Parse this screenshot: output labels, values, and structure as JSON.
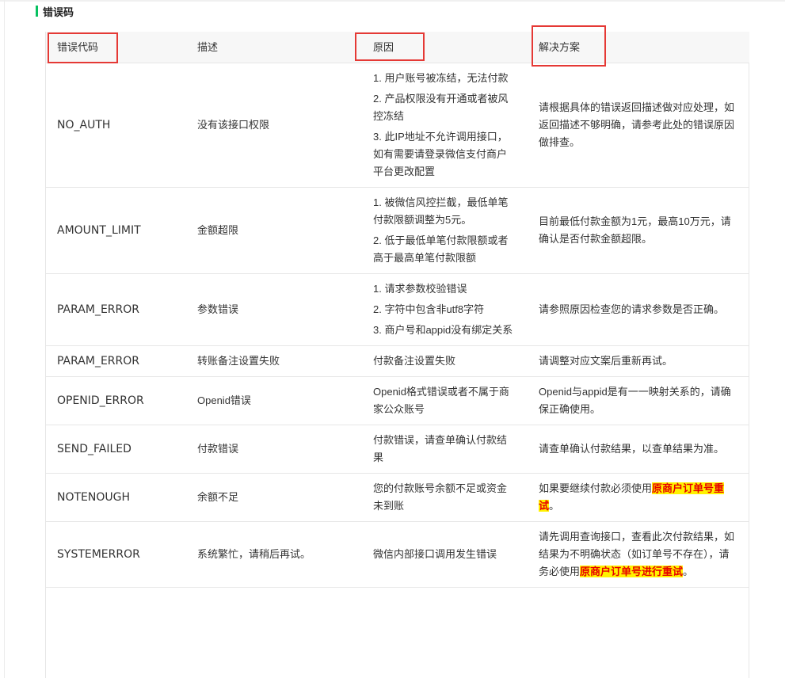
{
  "section_title": "错误码",
  "accent": "#07c160",
  "highlight_colors": {
    "background": "#fff200",
    "text": "#e60000"
  },
  "annotation_color": "#e53935",
  "table": {
    "headers": [
      "错误代码",
      "描述",
      "原因",
      "解决方案"
    ],
    "rows": [
      {
        "code": "NO_AUTH",
        "desc": "没有该接口权限",
        "reasons": [
          "1. 用户账号被冻结，无法付款",
          "2. 产品权限没有开通或者被风控冻结",
          "3. 此IP地址不允许调用接口，如有需要请登录微信支付商户平台更改配置"
        ],
        "solution": {
          "text": "请根据具体的错误返回描述做对应处理，如返回描述不够明确，请参考此处的错误原因做排查。"
        }
      },
      {
        "code": "AMOUNT_LIMIT",
        "desc": "金额超限",
        "reasons": [
          "1. 被微信风控拦截，最低单笔付款限额调整为5元。",
          "2. 低于最低单笔付款限额或者高于最高单笔付款限额"
        ],
        "solution": {
          "text": "目前最低付款金额为1元，最高10万元，请确认是否付款金额超限。"
        }
      },
      {
        "code": "PARAM_ERROR",
        "desc": "参数错误",
        "reasons": [
          "1. 请求参数校验错误",
          "2. 字符中包含非utf8字符",
          "3. 商户号和appid没有绑定关系"
        ],
        "solution": {
          "text": "请参照原因检查您的请求参数是否正确。"
        }
      },
      {
        "code": "PARAM_ERROR",
        "desc": "转账备注设置失败",
        "reasons": [
          "付款备注设置失败"
        ],
        "solution": {
          "text": "请调整对应文案后重新再试。"
        }
      },
      {
        "code": "OPENID_ERROR",
        "desc": "Openid错误",
        "reasons": [
          "Openid格式错误或者不属于商家公众账号"
        ],
        "solution": {
          "text": "Openid与appid是有一一映射关系的，请确保正确使用。"
        }
      },
      {
        "code": "SEND_FAILED",
        "desc": "付款错误",
        "reasons": [
          "付款错误，请查单确认付款结果"
        ],
        "solution": {
          "text": "请查单确认付款结果，以查单结果为准。"
        }
      },
      {
        "code": "NOTENOUGH",
        "desc": "余额不足",
        "reasons": [
          "您的付款账号余额不足或资金未到账"
        ],
        "solution": {
          "before": "如果要继续付款必须使用",
          "highlight": "原商户订单号重试",
          "after": "。"
        }
      },
      {
        "code": "SYSTEMERROR",
        "desc": "系统繁忙，请稍后再试。",
        "reasons": [
          "微信内部接口调用发生错误"
        ],
        "solution": {
          "before": "请先调用查询接口，查看此次付款结果，如结果为不明确状态（如订单号不存在），请务必使用",
          "highlight": "原商户订单号进行重试",
          "after": "。"
        }
      }
    ]
  }
}
